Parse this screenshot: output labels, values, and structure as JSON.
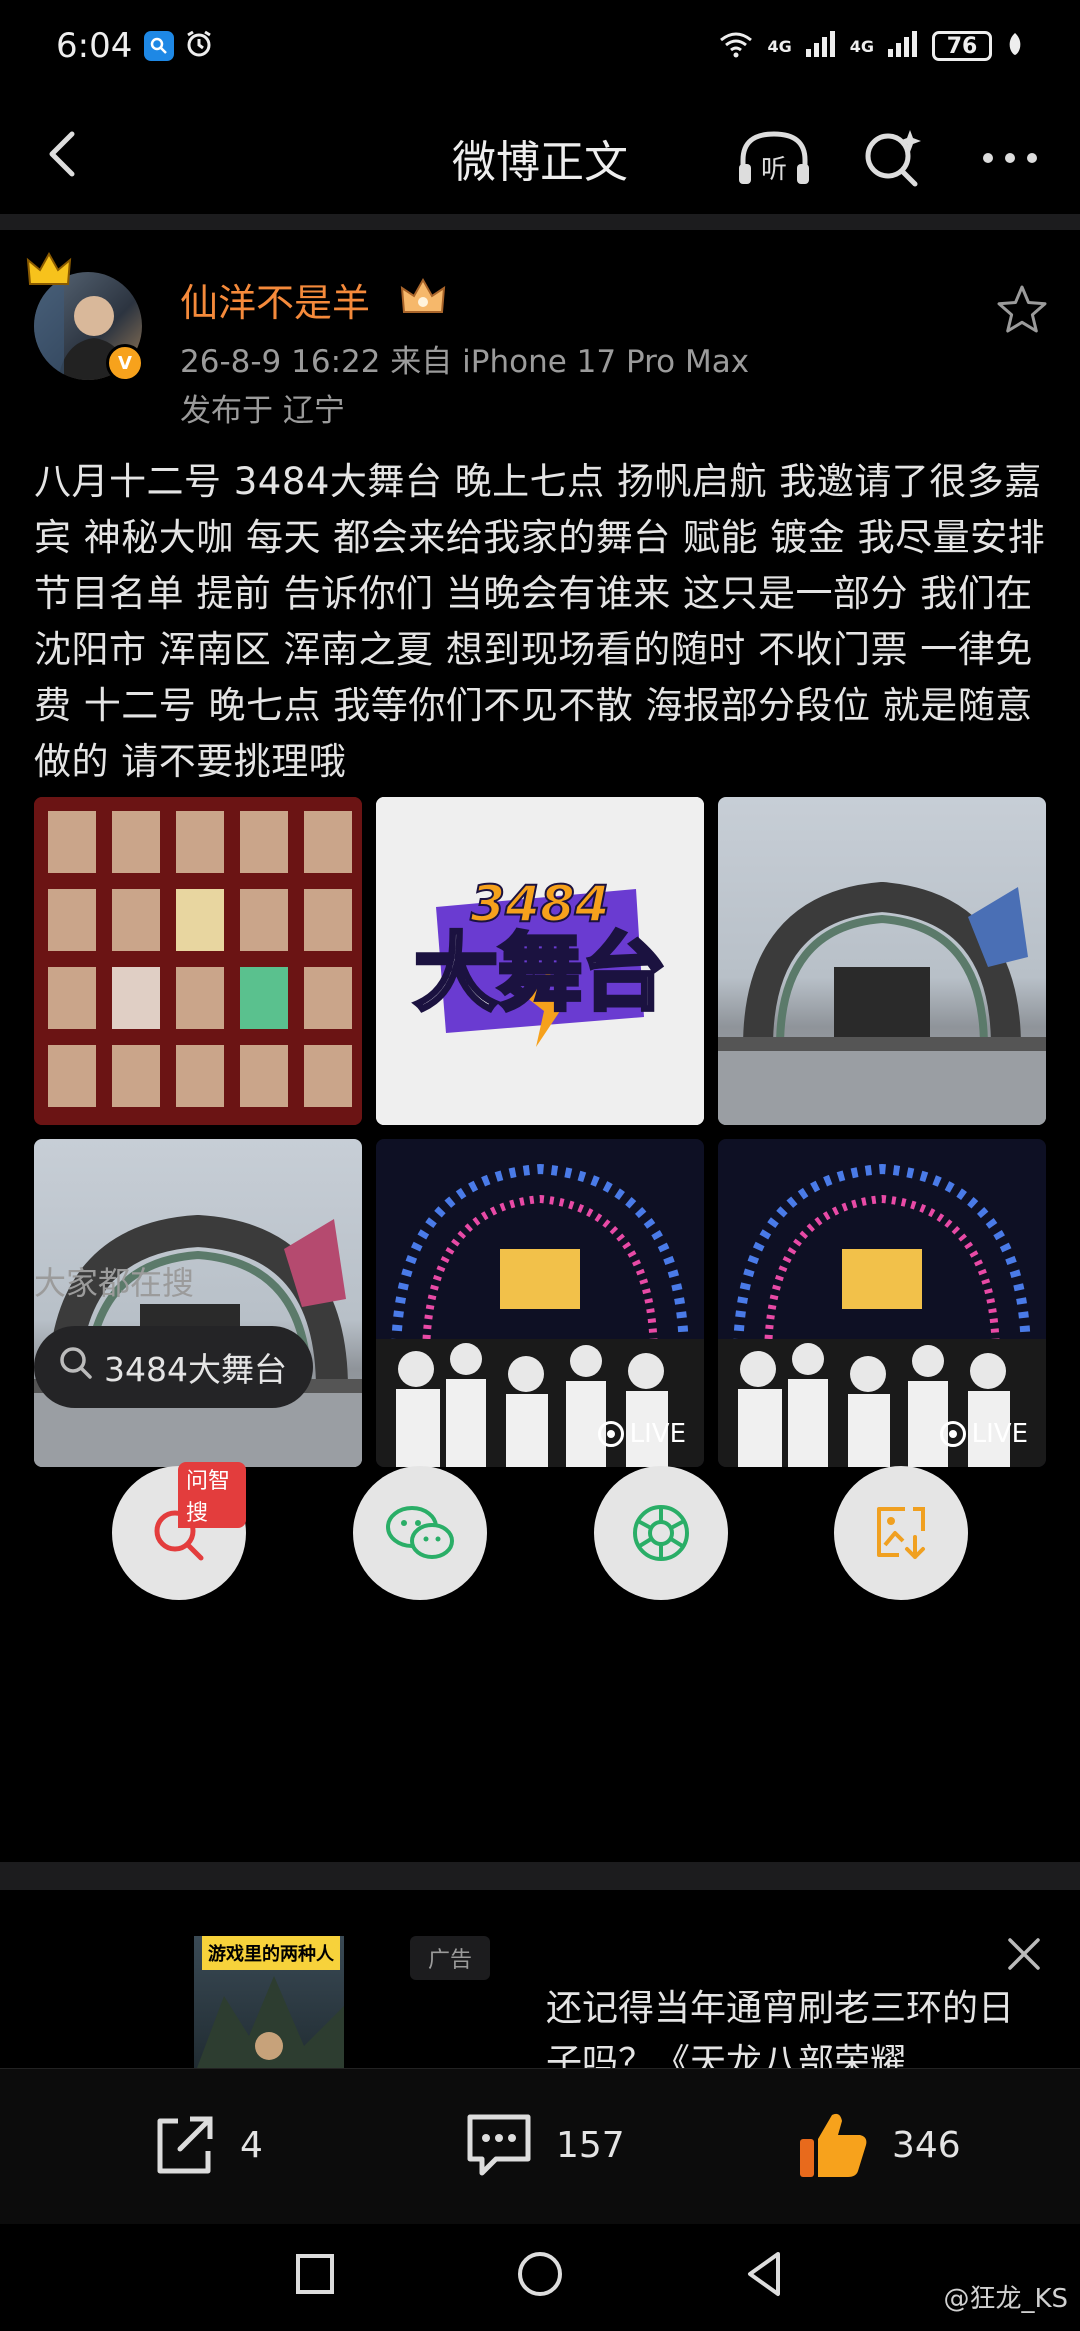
{
  "status_bar": {
    "time": "6:04",
    "net_1": "4G",
    "net_2": "4G",
    "battery": "76"
  },
  "nav": {
    "title": "微博正文"
  },
  "post": {
    "username": "仙洋不是羊",
    "meta": "26-8-9 16:22  来自 iPhone 17 Pro Max",
    "location": "发布于 辽宁",
    "text": "八月十二号 3484大舞台  晚上七点 扬帆启航 我邀请了很多嘉宾 神秘大咖 每天 都会来给我家的舞台 赋能 镀金 我尽量安排 节目名单 提前 告诉你们 当晚会有谁来 这只是一部分 我们在 沈阳市 浑南区 浑南之夏 想到现场看的随时 不收门票 一律免费 十二号 晚七点 我等你们不见不散 海报部分段位 就是随意做的 请不要挑理哦",
    "image_2": {
      "top": "3484",
      "bottom": "大舞台"
    },
    "live_label_1": "LIVE",
    "live_label_2": "LIVE"
  },
  "search": {
    "heading": "大家都在搜",
    "chip": "3484大舞台"
  },
  "share": {
    "ai_tag": "问智搜",
    "icons": [
      "ai-search-icon",
      "wechat-icon",
      "moments-icon",
      "save-image-icon"
    ]
  },
  "ad": {
    "thumb_label": "游戏里的两种人",
    "tag": "广告",
    "title": "还记得当年通宵刷老三环的日子吗？《天龙八部荣耀…"
  },
  "actions": {
    "repost_count": "4",
    "comment_count": "157",
    "like_count": "346"
  },
  "watermark": "@狂龙_KS",
  "colors": {
    "username": "#f58a3b",
    "like": "#f7a21c",
    "background": "#000000"
  }
}
